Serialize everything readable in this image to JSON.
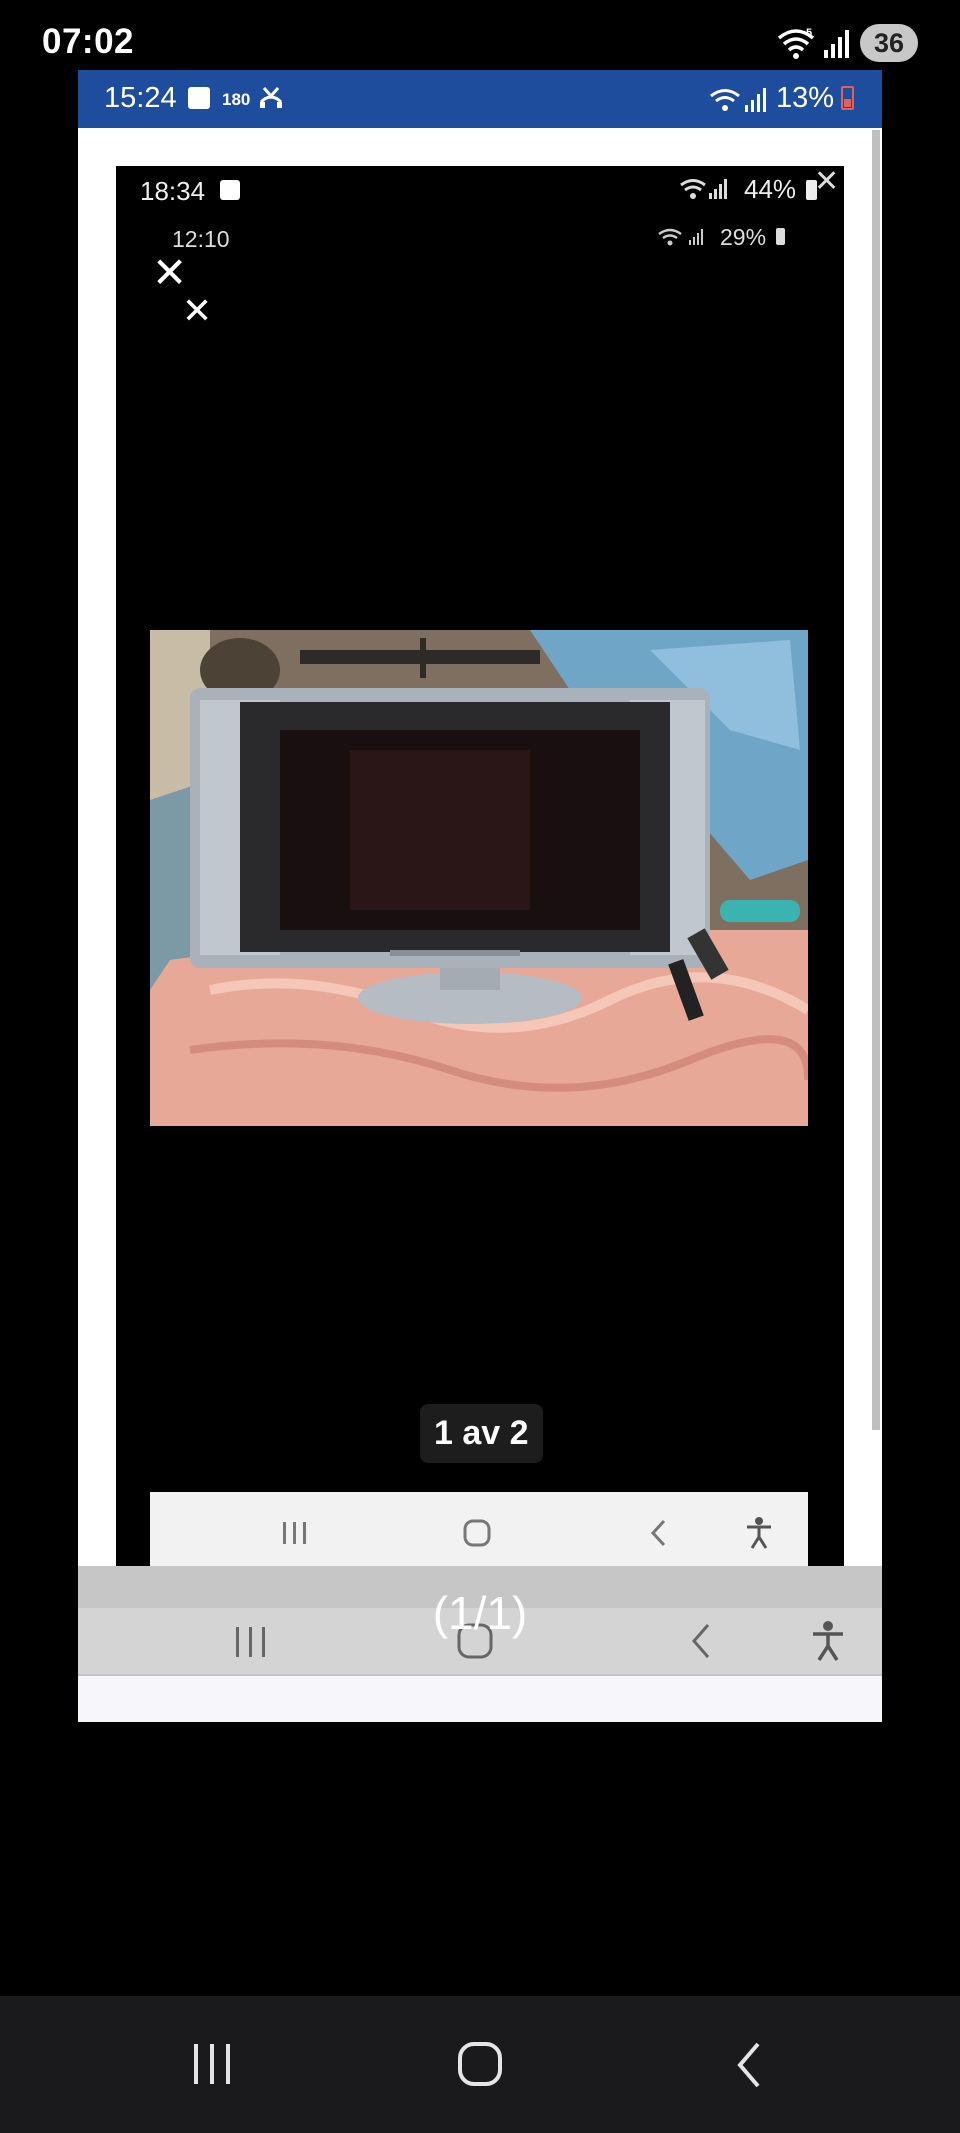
{
  "outer_status": {
    "time": "07:02",
    "battery": "36"
  },
  "frame1": {
    "status": {
      "time": "15:24",
      "count": "180",
      "battery_pct": "13%"
    },
    "counter": "(1/1)"
  },
  "frame2": {
    "status": {
      "time": "18:34",
      "battery_pct": "44%"
    }
  },
  "frame3": {
    "status": {
      "time": "12:10",
      "battery_pct": "29%"
    },
    "counter": "1 av 2"
  },
  "icons": {
    "close": "close-icon",
    "recents": "recents-icon",
    "home": "home-icon",
    "back": "back-icon",
    "accessibility": "accessibility-icon"
  },
  "colors": {
    "frame1_statusbar": "#1f4d9e",
    "outer_nav": "#1a1a1c",
    "battery_low": "#e06060"
  }
}
